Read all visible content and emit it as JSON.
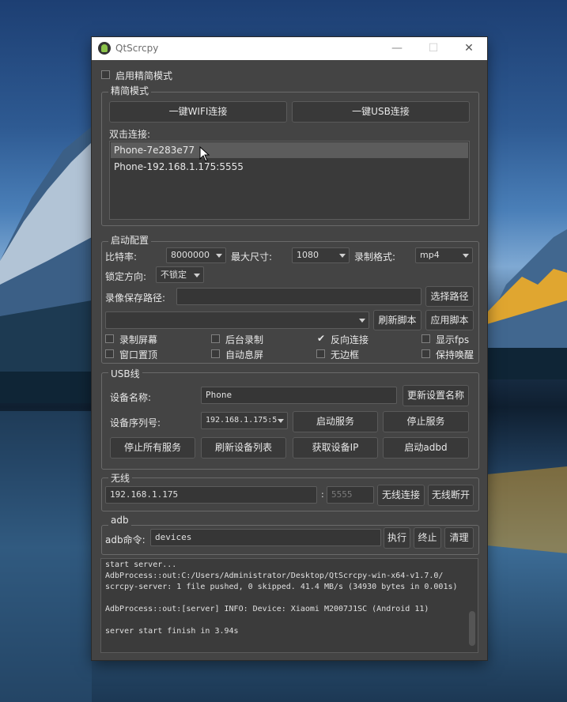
{
  "window": {
    "title": "QtScrcpy",
    "minimize_glyph": "—",
    "maximize_glyph": "☐",
    "close_glyph": "✕"
  },
  "simple_mode": {
    "checkbox_label": "启用精简模式",
    "checked": false
  },
  "simple_group": {
    "title": "精简模式",
    "wifi_button": "一键WIFI连接",
    "usb_button": "一键USB连接",
    "double_click_label": "双击连接:",
    "devices": [
      "Phone-7e283e77",
      "Phone-192.168.1.175:5555"
    ],
    "selected_index": 0
  },
  "start_config": {
    "title": "启动配置",
    "bitrate_label": "比特率:",
    "bitrate_value": "8000000",
    "maxsize_label": "最大尺寸:",
    "maxsize_value": "1080",
    "record_format_label": "录制格式:",
    "record_format_value": "mp4",
    "lock_orientation_label": "锁定方向:",
    "lock_orientation_value": "不锁定",
    "record_path_label": "录像保存路径:",
    "record_path_value": "",
    "select_path_button": "选择路径",
    "script_value": "",
    "refresh_script_button": "刷新脚本",
    "apply_script_button": "应用脚本",
    "checkboxes": [
      {
        "label": "录制屏幕",
        "checked": false
      },
      {
        "label": "后台录制",
        "checked": false
      },
      {
        "label": "反向连接",
        "checked": true
      },
      {
        "label": "显示fps",
        "checked": false
      },
      {
        "label": "窗口置顶",
        "checked": false
      },
      {
        "label": "自动息屏",
        "checked": false
      },
      {
        "label": "无边框",
        "checked": false
      },
      {
        "label": "保持唤醒",
        "checked": false
      }
    ]
  },
  "usb": {
    "title": "USB线",
    "device_name_label": "设备名称:",
    "device_name_value": "Phone",
    "update_name_button": "更新设置名称",
    "serial_label": "设备序列号:",
    "serial_value": "192.168.1.175:5",
    "start_service_button": "启动服务",
    "stop_service_button": "停止服务",
    "stop_all_button": "停止所有服务",
    "refresh_devices_button": "刷新设备列表",
    "get_ip_button": "获取设备IP",
    "start_adbd_button": "启动adbd"
  },
  "wireless": {
    "title": "无线",
    "ip_value": "192.168.1.175",
    "separator": ":",
    "port_placeholder": "5555",
    "connect_button": "无线连接",
    "disconnect_button": "无线断开"
  },
  "adb": {
    "title": "adb",
    "command_label": "adb命令:",
    "command_value": "devices",
    "execute_button": "执行",
    "terminate_button": "终止",
    "clear_button": "清理"
  },
  "console_lines": [
    "start server...",
    "AdbProcess::out:C:/Users/Administrator/Desktop/QtScrcpy-win-x64-v1.7.0/",
    "scrcpy-server: 1 file pushed, 0 skipped. 41.4 MB/s (34930 bytes in 0.001s)",
    "",
    "AdbProcess::out:[server] INFO: Device: Xiaomi M2007J1SC (Android 11)",
    "",
    "server start finish in 3.94s"
  ]
}
